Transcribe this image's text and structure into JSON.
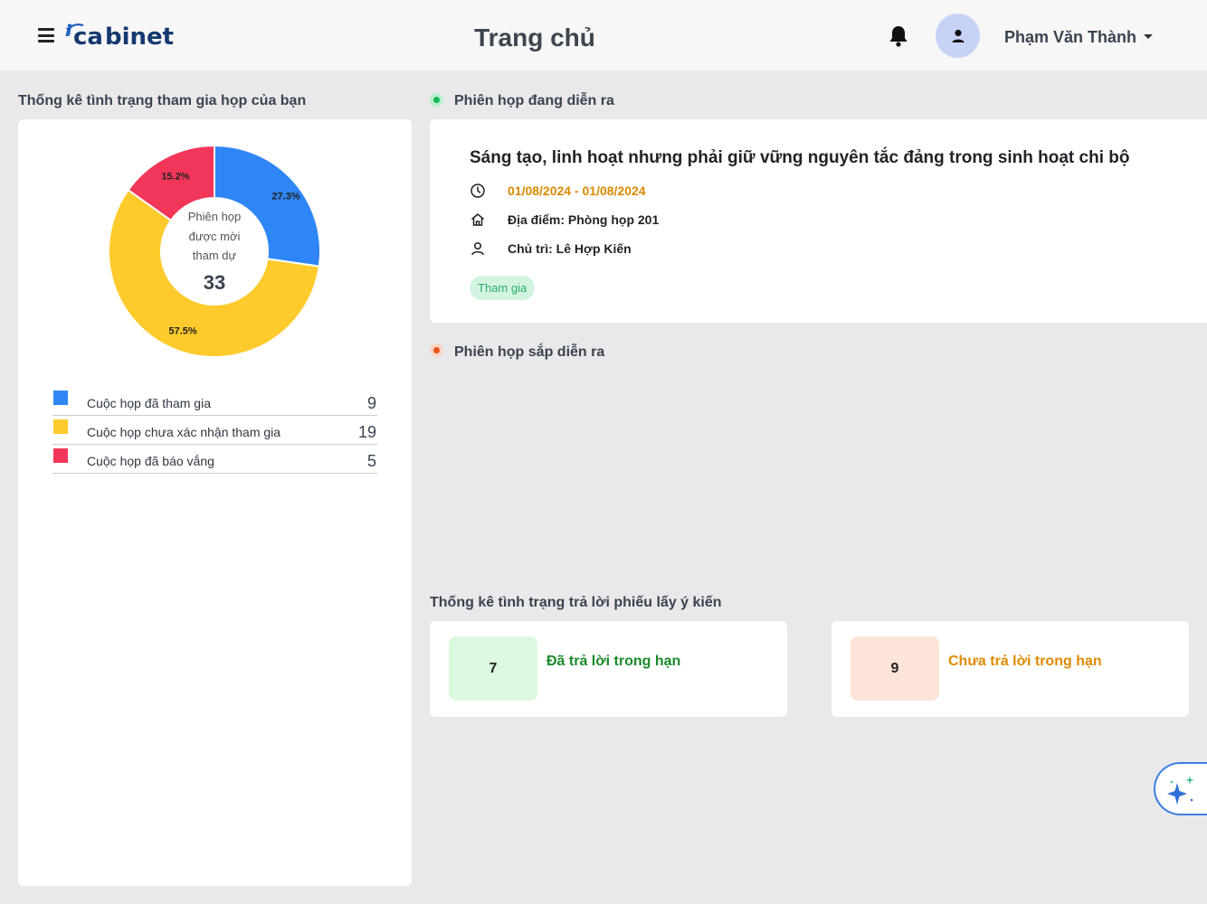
{
  "header": {
    "logo_text": "eCabinet",
    "title": "Trang chủ",
    "user_name": "Phạm Văn Thành"
  },
  "attendance": {
    "section_title": "Thống kê tình trạng tham gia họp của bạn",
    "center_label_lines": [
      "Phiên họp",
      "được mời",
      "tham dự"
    ],
    "total": "33",
    "legend": [
      {
        "label": "Cuộc họp đã tham gia",
        "value": "9",
        "color": "#2f86f6"
      },
      {
        "label": "Cuộc họp chưa xác nhận tham gia",
        "value": "19",
        "color": "#ffca2c"
      },
      {
        "label": "Cuộc họp đã báo vắng",
        "value": "5",
        "color": "#f2365a"
      }
    ]
  },
  "chart_data": {
    "type": "pie",
    "categories": [
      "Cuộc họp đã tham gia",
      "Cuộc họp chưa xác nhận tham gia",
      "Cuộc họp đã báo vắng"
    ],
    "values": [
      9,
      19,
      5
    ],
    "data_labels": [
      "27.3%",
      "57.5%",
      "15.2%"
    ],
    "colors": [
      "#2f86f6",
      "#ffca2c",
      "#f2365a"
    ],
    "donut": true
  },
  "ongoing": {
    "section_title": "Phiên họp đang diễn ra",
    "meeting_title": "Sáng tạo, linh hoạt nhưng phải giữ vững nguyên tắc đảng trong sinh hoạt chi bộ",
    "date_range": "01/08/2024 - 01/08/2024",
    "location": "Địa điểm: Phòng họp 201",
    "chair": "Chủ trì: Lê Hợp Kiến",
    "join_label": "Tham gia"
  },
  "upcoming": {
    "section_title": "Phiên họp sắp diễn ra"
  },
  "survey": {
    "section_title": "Thống kê tình trạng trả lời phiếu lấy ý kiến",
    "answered": {
      "count": "7",
      "label": "Đã trả lời trong hạn",
      "color": "#1a8a2a",
      "bg": "#dcf8df"
    },
    "unanswered": {
      "count": "9",
      "label": "Chưa trả lời trong hạn",
      "color": "#e08a00",
      "bg": "#fde4d8"
    }
  },
  "icons": [
    "menu-icon",
    "bell-icon",
    "user-icon",
    "clock-icon",
    "home-icon",
    "person-icon",
    "sparkle-icon"
  ]
}
